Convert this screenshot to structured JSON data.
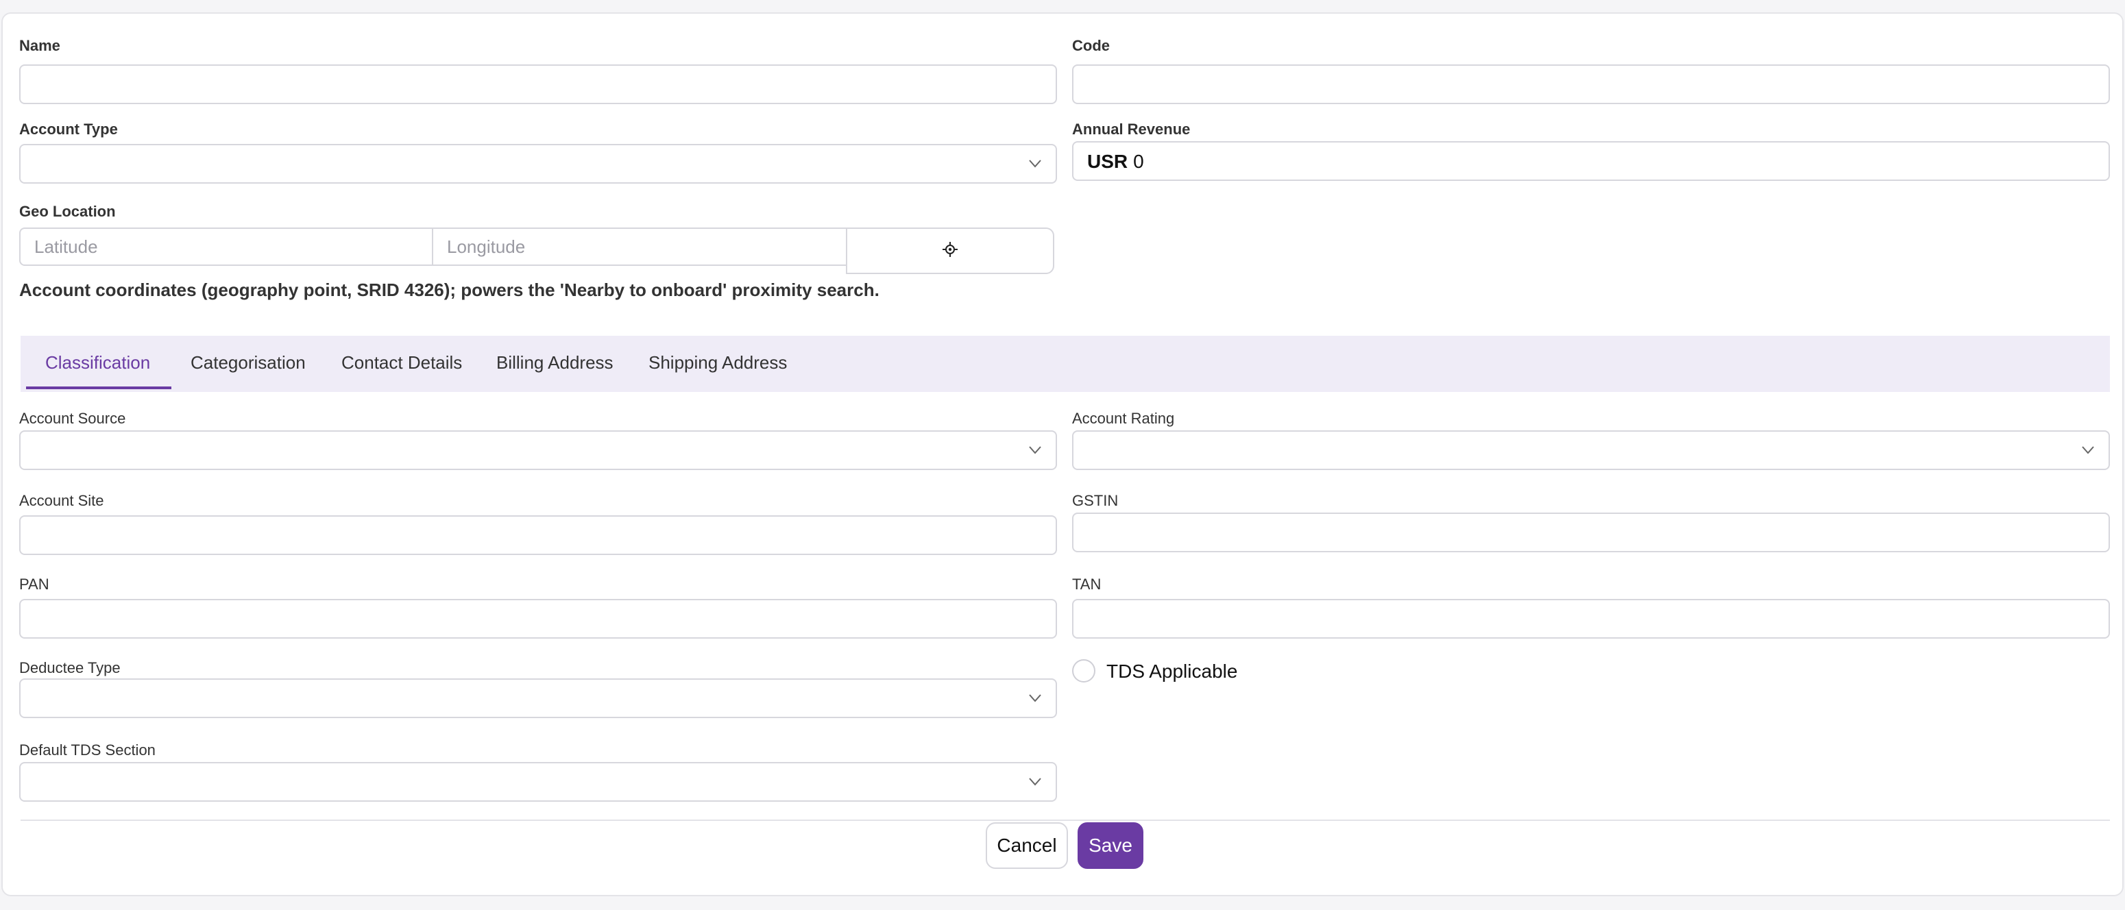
{
  "form": {
    "name_label": "Name",
    "name_value": "",
    "code_label": "Code",
    "code_value": "",
    "account_type_label": "Account Type",
    "account_type_value": "",
    "annual_revenue_label": "Annual Revenue",
    "annual_revenue_currency": "USR",
    "annual_revenue_value": "0",
    "geo_location_label": "Geo Location",
    "latitude_placeholder": "Latitude",
    "longitude_placeholder": "Longitude",
    "locate_icon": "crosshair-icon",
    "geo_help_text": "Account coordinates (geography point, SRID 4326); powers the 'Nearby to onboard' proximity search."
  },
  "tabs": [
    {
      "label": "Classification",
      "active": true
    },
    {
      "label": "Categorisation",
      "active": false
    },
    {
      "label": "Contact Details",
      "active": false
    },
    {
      "label": "Billing Address",
      "active": false
    },
    {
      "label": "Shipping Address",
      "active": false
    }
  ],
  "classification": {
    "account_source_label": "Account Source",
    "account_source_value": "",
    "account_rating_label": "Account Rating",
    "account_rating_value": "",
    "account_site_label": "Account Site",
    "account_site_value": "",
    "gstin_label": "GSTIN",
    "gstin_value": "",
    "pan_label": "PAN",
    "pan_value": "",
    "tan_label": "TAN",
    "tan_value": "",
    "deductee_type_label": "Deductee Type",
    "deductee_type_value": "",
    "tds_applicable_label": "TDS Applicable",
    "tds_applicable_checked": false,
    "default_tds_section_label": "Default TDS Section",
    "default_tds_section_value": ""
  },
  "actions": {
    "cancel_label": "Cancel",
    "save_label": "Save"
  },
  "colors": {
    "accent": "#6a3ba3",
    "tab_bar_bg": "#efecf7",
    "border": "#d7d7dd"
  }
}
